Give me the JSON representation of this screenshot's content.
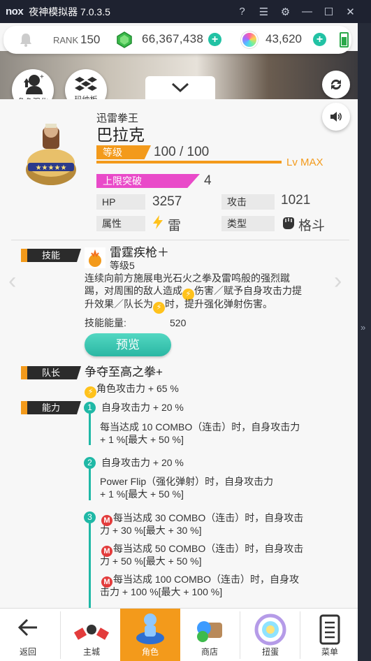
{
  "window": {
    "logo": "nox",
    "title": "夜神模拟器 7.0.3.5"
  },
  "topbar": {
    "rank_label": "RANK",
    "rank_value": "150",
    "coins": "66,367,438",
    "crystals": "43,620"
  },
  "tools": {
    "enhance": "角色强化",
    "board": "玛纳板"
  },
  "character": {
    "title": "迅雷拳王",
    "name": "巴拉克",
    "level_label": "等级",
    "level_value": "100 / 100",
    "lv_max": "Lv MAX",
    "limit_label": "上限突破",
    "limit_value": "4",
    "hp_label": "HP",
    "hp_value": "3257",
    "atk_label": "攻击",
    "atk_value": "1021",
    "attr_label": "属性",
    "attr_value": "雷",
    "type_label": "类型",
    "type_value": "格斗"
  },
  "skill": {
    "tag": "技能",
    "name": "雷霆疾枪＋",
    "level": "等级5",
    "desc1": "连续向前方施展电光石火之拳及雷鸣般的强烈蹴",
    "desc2a": "踢，对周围的敌人造成",
    "desc2b": "伤害／赋予自身攻击力提",
    "desc3a": "升效果／队长为",
    "desc3b": "时，提升强化弹射伤害。",
    "energy_label": "技能能量:",
    "energy_value": "520",
    "preview": "预览"
  },
  "leader": {
    "tag": "队长",
    "name": "争夺至高之拳+",
    "effect": "角色攻击力 + 65 %"
  },
  "ability": {
    "tag": "能力",
    "a1_title": "自身攻击力 + 20 %",
    "a1_l1": "每当达成 10 COMBO（连击）时，自身攻击力",
    "a1_l2": "+ 1 %[最大 + 50 %]",
    "a2_title": "自身攻击力 + 20 %",
    "a2_l1": "Power Flip（强化弹射）时，自身攻击力",
    "a2_l2": "+ 1 %[最大 + 50 %]",
    "a3_l1": "每当达成 30 COMBO（连击）时，自身攻击",
    "a3_l2": "力 + 30 %[最大 + 30 %]",
    "a3_l3": "每当达成 50 COMBO（连击）时，自身攻击",
    "a3_l4": "力 + 50 %[最大 + 50 %]",
    "a3_l5": "每当达成 100 COMBO（连击）时，自身攻",
    "a3_l6": "击力 + 100 %[最大 + 100 %]",
    "n1": "1",
    "n2": "2",
    "n3": "3",
    "m": "M"
  },
  "nav": {
    "back": "返回",
    "city": "主城",
    "character": "角色",
    "shop": "商店",
    "gacha": "扭蛋",
    "menu": "菜单"
  },
  "colors": {
    "accent": "#f39a1b",
    "teal": "#1fb8a6",
    "pink": "#e94ac9"
  }
}
